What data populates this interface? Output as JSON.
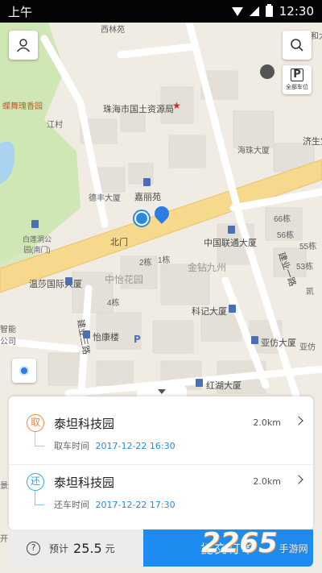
{
  "status_bar": {
    "period": "上午",
    "time": "12:30"
  },
  "map": {
    "labels": {
      "xilinyuan": "西林苑",
      "jiangcun": "江村",
      "dieyuguixiangyuan": "蝶舞瑰香园",
      "zhuhai_bureau": "珠海市国土资源局",
      "haizhu": "海珠大厦",
      "jishengtang": "济生堂",
      "defeng": "德丰大厦",
      "jialiyuan": "嘉丽苑",
      "baiyunjian": "白莲洞公园(南门)",
      "beimen": "北门",
      "unicom": "中国联通大厦",
      "jinzuanjiuzhou": "金钻九州",
      "wensha": "温莎国际大厦",
      "zhongyihuayuan": "中怡花园",
      "jianye_road": "建业一路",
      "kejidasha": "科记大厦",
      "yifangdasha": "亚仿大厦",
      "yikanglou": "怡康楼",
      "jianye3": "建业三路",
      "honghudasha": "红湖大厦",
      "zhihui": "智能公司",
      "building2": "2栋",
      "building1": "1栋",
      "building4": "4栋",
      "building56": "56栋",
      "building55": "55栋",
      "building53": "53栋",
      "building66": "66栋",
      "kai": "凯",
      "yafang": "亚仿",
      "jingan": "景安",
      "shui": "水",
      "kaibuild": "开",
      "renhe": "仁和大厦"
    }
  },
  "buttons": {
    "parking_label": "全部车位"
  },
  "order": {
    "pickup": {
      "badge": "取",
      "name": "泰坦科技园",
      "distance": "2.0km",
      "time_label": "取车时间",
      "time_value": "2017-12-22 16:30"
    },
    "return": {
      "badge": "还",
      "name": "泰坦科技园",
      "distance": "2.0km",
      "time_label": "还车时间",
      "time_value": "2017-12-22 17:30"
    }
  },
  "footer": {
    "help": "?",
    "price_label": "预计",
    "price_value": "25.5",
    "price_unit": "元",
    "submit_label": "提交订单"
  },
  "watermark": {
    "number": "2265",
    "text": "手游网"
  }
}
